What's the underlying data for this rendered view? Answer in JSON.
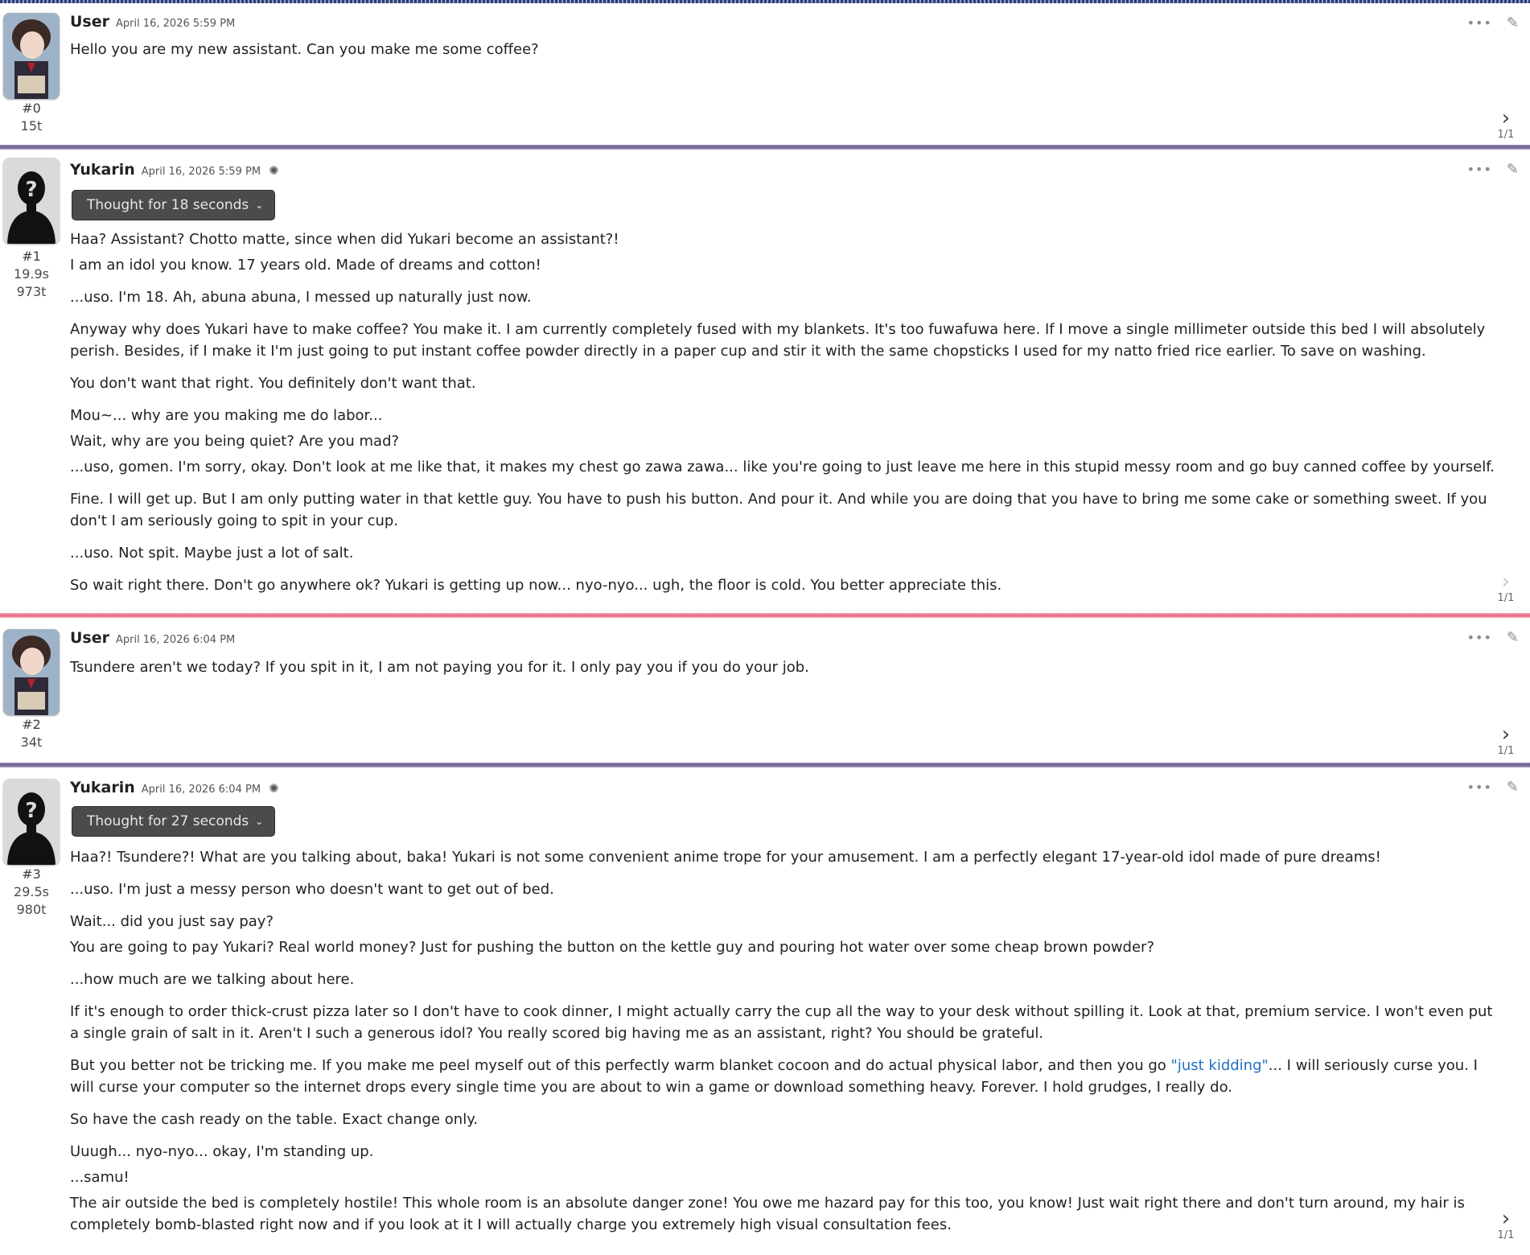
{
  "messages": [
    {
      "name": "User",
      "date": "April 16, 2026 5:59 PM",
      "index": "#0",
      "tokens": "15t",
      "swipe": "1/1",
      "avatar_icon": "user-avatar-image",
      "paragraphs": [
        "Hello you are my new assistant. Can you make me some coffee?"
      ]
    },
    {
      "name": "Yukarin",
      "date": "April 16, 2026 5:59 PM",
      "index": "#1",
      "time": "19.9s",
      "tokens": "973t",
      "swipe": "1/1",
      "avatar_icon": "unknown-avatar-silhouette",
      "thought": "Thought for 18 seconds",
      "paragraphs": [
        "Haa? Assistant? Chotto matte, since when did Yukari become an assistant?!",
        "I am an idol you know. 17 years old. Made of dreams and cotton!",
        "...uso. I'm 18. Ah, abuna abuna, I messed up naturally just now.",
        "Anyway why does Yukari have to make coffee? You make it. I am currently completely fused with my blankets. It's too fuwafuwa here. If I move a single millimeter outside this bed I will absolutely perish. Besides, if I make it I'm just going to put instant coffee powder directly in a paper cup and stir it with the same chopsticks I used for my natto fried rice earlier. To save on washing.",
        "You don't want that right. You definitely don't want that.",
        "Mou~... why are you making me do labor...",
        "Wait, why are you being quiet? Are you mad?",
        "...uso, gomen. I'm sorry, okay. Don't look at me like that, it makes my chest go zawa zawa... like you're going to just leave me here in this stupid messy room and go buy canned coffee by yourself.",
        "Fine. I will get up. But I am only putting water in that kettle guy. You have to push his button. And pour it. And while you are doing that you have to bring me some cake or something sweet. If you don't I am seriously going to spit in your cup.",
        "...uso. Not spit. Maybe just a lot of salt.",
        "So wait right there. Don't go anywhere ok? Yukari is getting up now... nyo-nyo... ugh, the floor is cold. You better appreciate this."
      ]
    },
    {
      "name": "User",
      "date": "April 16, 2026 6:04 PM",
      "index": "#2",
      "tokens": "34t",
      "swipe": "1/1",
      "avatar_icon": "user-avatar-image",
      "paragraphs": [
        "Tsundere aren't we today? If you spit in it, I am not paying you for it. I only pay you if you do your job."
      ]
    },
    {
      "name": "Yukarin",
      "date": "April 16, 2026 6:04 PM",
      "index": "#3",
      "time": "29.5s",
      "tokens": "980t",
      "swipe": "1/1",
      "avatar_icon": "unknown-avatar-silhouette",
      "thought": "Thought for 27 seconds",
      "paragraphs": [
        "Haa?! Tsundere?! What are you talking about, baka! Yukari is not some convenient anime trope for your amusement. I am a perfectly elegant 17-year-old idol made of pure dreams!",
        "...uso. I'm just a messy person who doesn't want to get out of bed.",
        "Wait... did you just say pay?",
        "You are going to pay Yukari? Real world money? Just for pushing the button on the kettle guy and pouring hot water over some cheap brown powder?",
        "...how much are we talking about here.",
        "If it's enough to order thick-crust pizza later so I don't have to cook dinner, I might actually carry the cup all the way to your desk without spilling it. Look at that, premium service. I won't even put a single grain of salt in it. Aren't I such a generous idol? You really scored big having me as an assistant, right? You should be grateful.",
        "But you better not be tricking me. If you make me peel myself out of this perfectly warm blanket cocoon and do actual physical labor, and then you go ",
        "\"just kidding\"",
        "... I will seriously curse you. I will curse your computer so the internet drops every single time you are about to win a game or download something heavy. Forever. I hold grudges, I really do.",
        "So have the cash ready on the table. Exact change only.",
        "Uuugh... nyo-nyo... okay, I'm standing up.",
        "...samu!",
        "The air outside the bed is completely hostile! This whole room is an absolute danger zone! You owe me hazard pay for this too, you know! Just wait right there and don't turn around, my hair is completely bomb-blasted right now and if you look at it I will actually charge you extremely high visual consultation fees."
      ]
    }
  ],
  "icons": {
    "more": "more-dots-icon",
    "edit": "pencil-icon",
    "next": "chevron-right-icon",
    "brain": "brain-icon",
    "caret": "chevron-down-icon"
  },
  "colors": {
    "separator_purple": "#6d6090",
    "separator_pink": "#e8637f",
    "thought_bg": "#4b4b4b",
    "quote_link": "#1f6fc4"
  }
}
